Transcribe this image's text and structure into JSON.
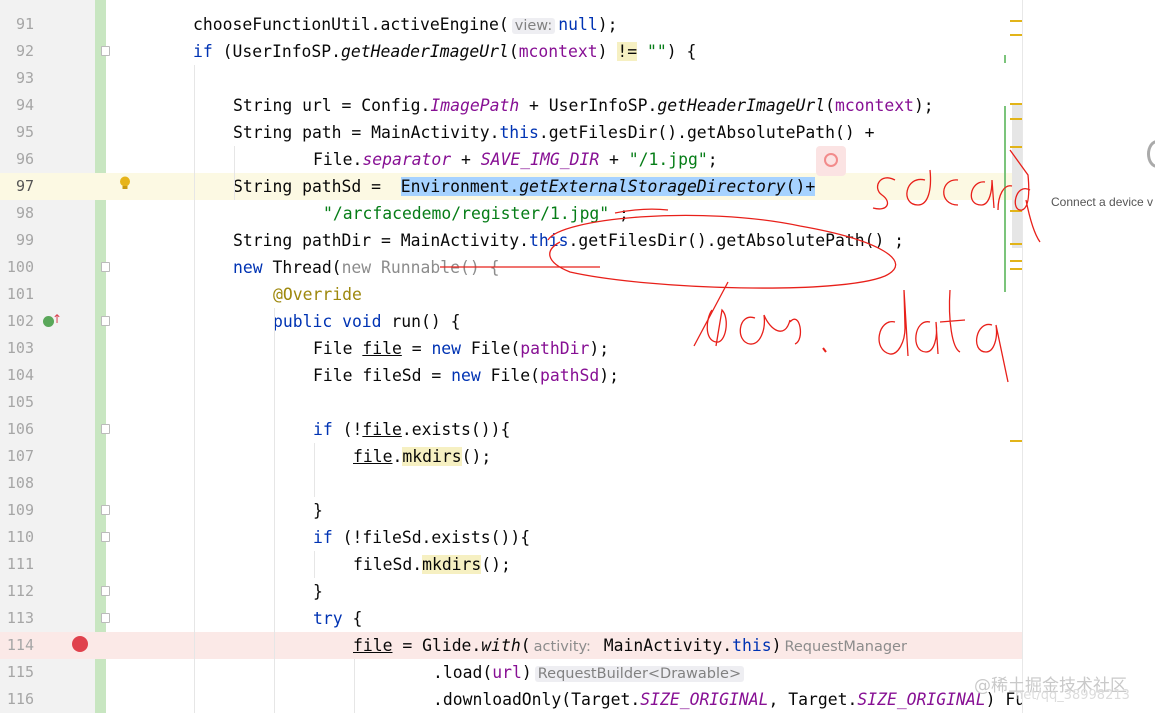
{
  "editor": {
    "lines": [
      {
        "n": "91"
      },
      {
        "n": "92"
      },
      {
        "n": "93"
      },
      {
        "n": "94"
      },
      {
        "n": "95"
      },
      {
        "n": "96"
      },
      {
        "n": "97"
      },
      {
        "n": "98"
      },
      {
        "n": "99"
      },
      {
        "n": "100"
      },
      {
        "n": "101"
      },
      {
        "n": "102"
      },
      {
        "n": "103"
      },
      {
        "n": "104"
      },
      {
        "n": "105"
      },
      {
        "n": "106"
      },
      {
        "n": "107"
      },
      {
        "n": "108"
      },
      {
        "n": "109"
      },
      {
        "n": "110"
      },
      {
        "n": "111"
      },
      {
        "n": "112"
      },
      {
        "n": "113"
      },
      {
        "n": "114"
      },
      {
        "n": "115"
      },
      {
        "n": "116"
      }
    ],
    "tok": {
      "l91_a": "chooseFunctionUtil.activeEngine(",
      "l91_hint": "view:",
      "l91_b": "null",
      "l91_c": ");",
      "l92_kw": "if",
      "l92_a": " (UserInfoSP.",
      "l92_m": "getHeaderImageUrl",
      "l92_b": "(",
      "l92_p": "mcontext",
      "l92_c": ") ",
      "l92_op": "!=",
      "l92_d": " ",
      "l92_s": "\"\"",
      "l92_e": ") {",
      "l94_a": "String url = Config.",
      "l94_f": "ImagePath",
      "l94_b": " + UserInfoSP.",
      "l94_m": "getHeaderImageUrl",
      "l94_c": "(",
      "l94_p": "mcontext",
      "l94_d": ");",
      "l95_a": "String path = MainActivity.",
      "l95_kw": "this",
      "l95_b": ".getFilesDir().getAbsolutePath() +",
      "l96_a": "File.",
      "l96_f": "separator",
      "l96_b": " + ",
      "l96_f2": "SAVE_IMG_DIR",
      "l96_c": " + ",
      "l96_s": "\"/1.jpg\"",
      "l96_d": ";",
      "l97_a": "String pathSd =  ",
      "l97_sel1": "Environment.",
      "l97_sel2": "getExternalStorageDirectory",
      "l97_sel3": "()+",
      "l98_s": "\"/arcfacedemo/register/1.jpg\"",
      "l98_b": " ;",
      "l99_a": "String pathDir = MainActivity.",
      "l99_kw": "this",
      "l99_b": ".getFilesDir().getAbsolutePath() ;",
      "l100_kw": "new",
      "l100_a": " Thread(",
      "l100_g": "new Runnable() {",
      "l101_ann": "@Override",
      "l102_kw": "public void",
      "l102_a": " run() {",
      "l103_a": "File ",
      "l103_v": "file",
      "l103_b": " = ",
      "l103_kw": "new",
      "l103_c": " File(",
      "l103_p": "pathDir",
      "l103_d": ");",
      "l104_a": "File fileSd = ",
      "l104_kw": "new",
      "l104_c": " File(",
      "l104_p": "pathSd",
      "l104_d": ");",
      "l106_kw": "if",
      "l106_a": " (!",
      "l106_v": "file",
      "l106_b": ".exists()){",
      "l107_v": "file",
      "l107_a": ".",
      "l107_m": "mkdirs",
      "l107_b": "();",
      "l109_a": "}",
      "l110_kw": "if",
      "l110_a": " (!fileSd.exists()){",
      "l111_a": "fileSd.",
      "l111_m": "mkdirs",
      "l111_b": "();",
      "l112_a": "}",
      "l113_kw": "try",
      "l113_a": " {",
      "l114_v": "file",
      "l114_a": " = Glide.",
      "l114_m": "with",
      "l114_b": "(",
      "l114_hint": "activity:",
      "l114_c": " MainActivity.",
      "l114_kw": "this",
      "l114_d": ")",
      "l114_h2": "RequestManager",
      "l115_a": ".",
      "l115_m": "load",
      "l115_b": "(",
      "l115_p": "url",
      "l115_c": ")",
      "l115_hint": "RequestBuilder<Drawable>",
      "l116_a": ".downloadOnly(Target.",
      "l116_f": "SIZE_ORIGINAL",
      "l116_b": ", Target.",
      "l116_f2": "SIZE_ORIGINAL",
      "l116_c": ") Fu"
    }
  },
  "side_panel": {
    "connect_text": "Connect a device v",
    "gear_icon": "gear-icon"
  },
  "watermark": {
    "text": "@稀土掘金技术社区",
    "faded": "net/qq_38998213"
  },
  "annotations": {
    "ink1": "sdcard",
    "ink2": "/data. data",
    "ink_color": "#e8201a"
  }
}
